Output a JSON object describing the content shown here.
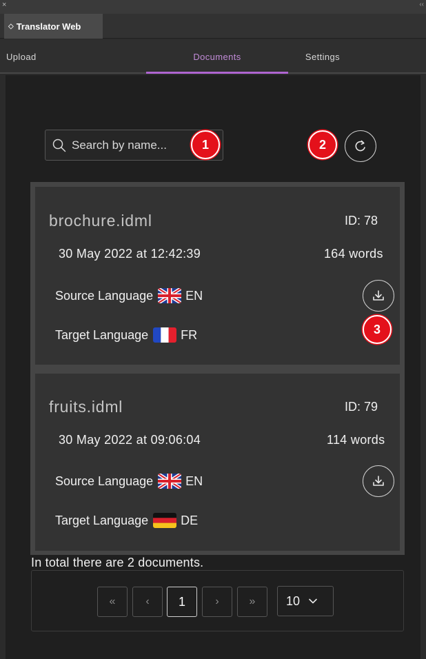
{
  "window": {
    "panel_title": "Translator Web",
    "close_glyph": "×",
    "collapse_glyph": "‹‹"
  },
  "tabs": [
    {
      "label": "Upload"
    },
    {
      "label": "Documents",
      "active": true
    },
    {
      "label": "Settings"
    }
  ],
  "search": {
    "placeholder": "Search by name...",
    "value": ""
  },
  "markers": [
    "1",
    "2",
    "3"
  ],
  "documents": [
    {
      "name": "brochure.idml",
      "id": "ID: 78",
      "date": "30 May 2022 at 12:42:39",
      "words": "164 words",
      "source_label": "Source Language",
      "source_flag": "gb-flag-icon",
      "source_code": "EN",
      "target_label": "Target Language",
      "target_flag": "fr-flag-icon",
      "target_code": "FR"
    },
    {
      "name": "fruits.idml",
      "id": "ID: 79",
      "date": "30 May 2022 at 09:06:04",
      "words": "114 words",
      "source_label": "Source Language",
      "source_flag": "gb-flag-icon",
      "source_code": "EN",
      "target_label": "Target Language",
      "target_flag": "de-flag-icon",
      "target_code": "DE"
    }
  ],
  "footer": {
    "total_text": "In total there are 2 documents."
  },
  "pagination": {
    "first": "«",
    "prev": "‹",
    "current": "1",
    "next": "›",
    "last": "»",
    "page_size": "10"
  },
  "colors": {
    "accent": "#b066d1",
    "marker": "#e4111b",
    "background": "#1f1f1f",
    "card": "#333333"
  }
}
